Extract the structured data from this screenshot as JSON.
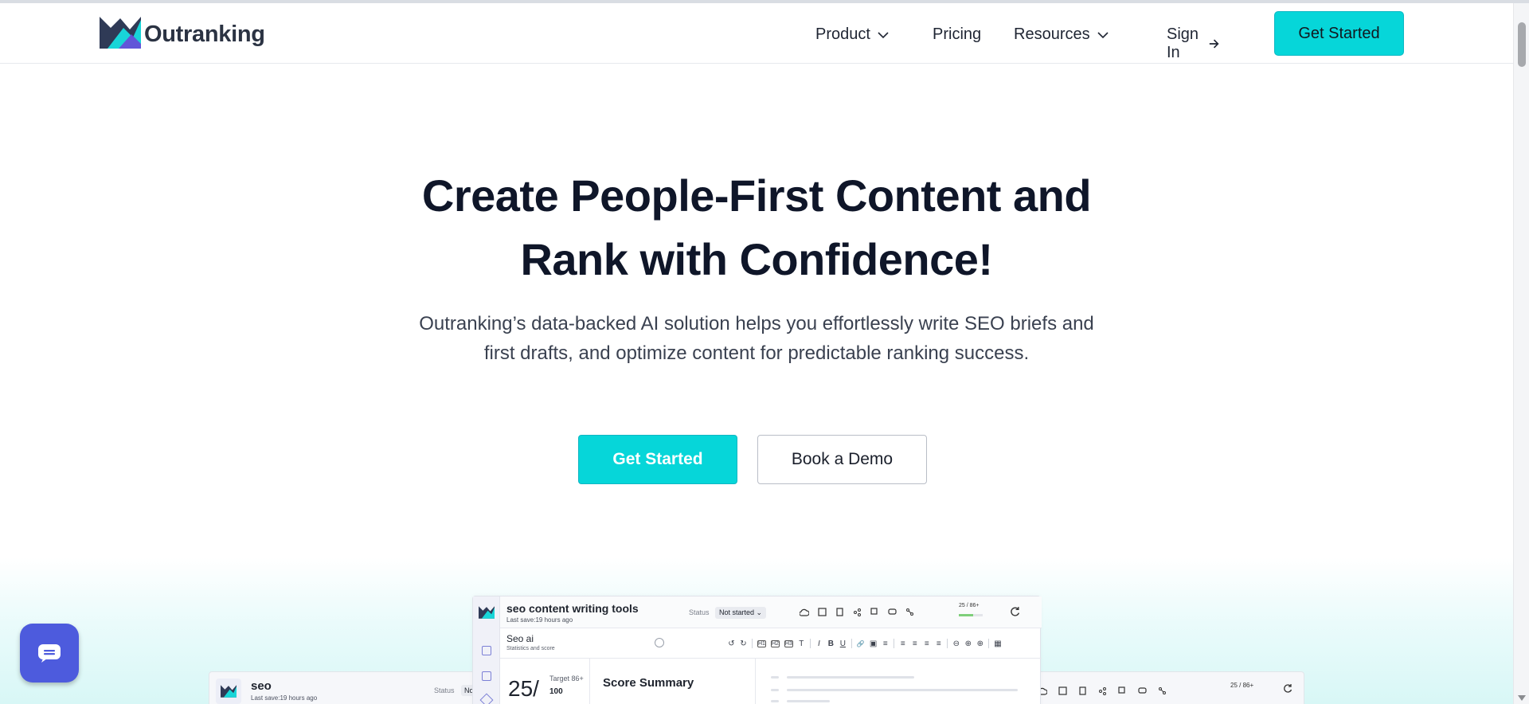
{
  "brand": {
    "name": "Outranking",
    "accent": "#06d6d9",
    "chat_color": "#4d5bdd",
    "heading_color": "#0f1629"
  },
  "nav": {
    "product": "Product",
    "pricing": "Pricing",
    "resources": "Resources",
    "sign_in": "Sign In",
    "cta": "Get Started"
  },
  "hero": {
    "title_line1": "Create People-First Content and",
    "title_line2": "Rank with Confidence!",
    "sub_line1": "Outranking’s data-backed AI solution helps you effortlessly write SEO briefs and",
    "sub_line2": "first drafts, and optimize content for predictable ranking success.",
    "primary_cta": "Get Started",
    "secondary_cta": "Book a Demo"
  },
  "mockup_front": {
    "doc_title": "seo content writing tools",
    "last_save": "Last save:19 hours ago",
    "status_label": "Status",
    "status_value": "Not started",
    "score": "25 / 86+",
    "panel_title": "Seo ai",
    "panel_sub": "Statistics and score",
    "big_score": "25/",
    "target": "Target 86+",
    "max": "100",
    "summary_title": "Score Summary",
    "editor_tools": [
      "↺",
      "↻",
      "H1",
      "H2",
      "H3",
      "T",
      "I",
      "B",
      "U",
      "🔗",
      "▣",
      "≡",
      "≡",
      "≡",
      "≡",
      "≡",
      "⊖",
      "⊕",
      "⊕",
      "▦"
    ]
  },
  "mockup_back": {
    "doc_title": "seo",
    "last_save": "Last save:19 hours ago",
    "status_label": "Status",
    "status_value": "No",
    "score": "25 / 86+"
  },
  "icons": {
    "chevron": "chevron-down-icon",
    "arrow": "arrow-right-icon",
    "chat": "chat-icon",
    "refresh": "refresh-icon"
  }
}
